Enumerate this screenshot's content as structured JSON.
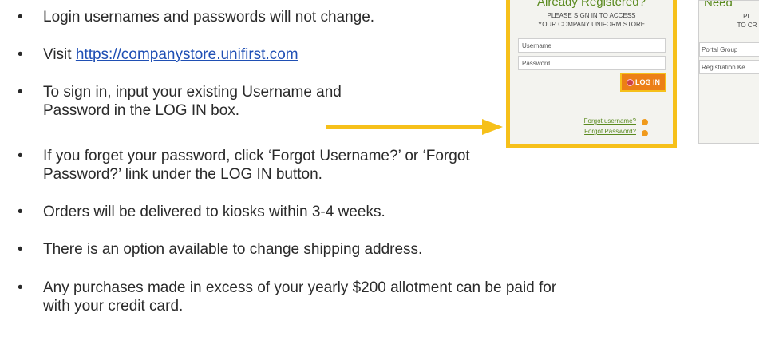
{
  "bullets": [
    {
      "text": "Login usernames and passwords will not change."
    },
    {
      "prefix": "Visit ",
      "link": "https://companystore.unifirst.com"
    },
    {
      "line1": "To sign in, input your existing Username and",
      "line2": "Password in the LOG IN box."
    },
    {
      "line1": "If you forget your password, click ‘Forgot Username?’ or ‘Forgot",
      "line2": "Password?’ link under the LOG IN button."
    },
    {
      "text": "Orders will be delivered to kiosks within 3-4 weeks."
    },
    {
      "text": "There is an option available to change shipping address."
    },
    {
      "line1": "Any purchases made in excess of your yearly $200 allotment can be paid for",
      "line2": "with your credit card."
    }
  ],
  "bullet_symbol": "•",
  "login_box": {
    "title": "Already Registered?",
    "subtitle_line1": "PLEASE SIGN IN TO ACCESS",
    "subtitle_line2": "YOUR COMPANY UNIFORM STORE",
    "username_placeholder": "Username",
    "password_placeholder": "Password",
    "login_label": "LOG IN",
    "forgot_username": "Forgot username?",
    "forgot_password": "Forgot Password?"
  },
  "register_box": {
    "title": "Need",
    "subtitle_line1": "PL",
    "subtitle_line2": "TO CR",
    "portal_group_placeholder": "Portal Group",
    "registration_key_placeholder": "Registration Ke"
  },
  "colors": {
    "highlight": "#f6c01a",
    "brand_green": "#5a8a1f",
    "link": "#1f4fb4",
    "login_button": "#ec7f16"
  },
  "icons": {
    "arrow": "right-arrow-icon"
  }
}
